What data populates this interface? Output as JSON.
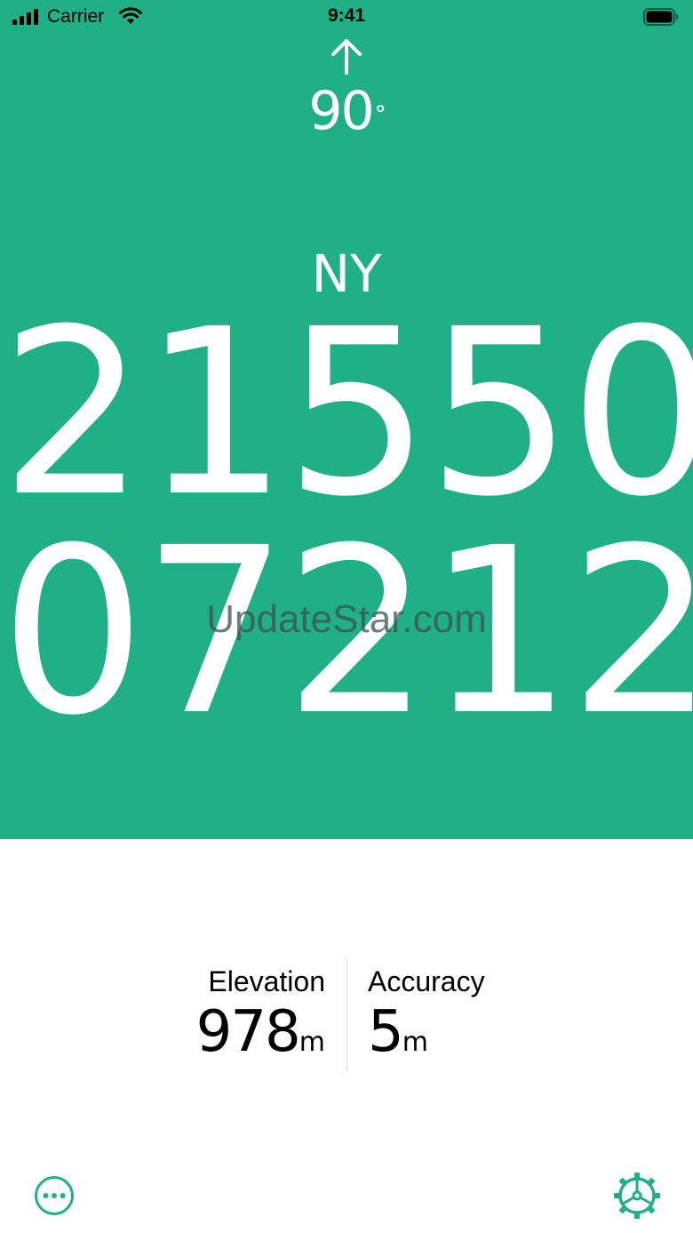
{
  "status_bar": {
    "carrier": "Carrier",
    "time": "9:41"
  },
  "heading": {
    "value": "90",
    "unit": "°"
  },
  "location": {
    "zone": "NY",
    "line1": "21550",
    "line2": "07212"
  },
  "watermark": "UpdateStar.com",
  "stats": {
    "elevation": {
      "label": "Elevation",
      "value": "978",
      "unit": "m"
    },
    "accuracy": {
      "label": "Accuracy",
      "value": "5",
      "unit": "m"
    }
  },
  "icons": {
    "more": "more-icon",
    "settings": "settings-icon",
    "heading_arrow": "arrow-up-icon"
  },
  "colors": {
    "accent": "#20b088",
    "background": "#ffffff",
    "text_dark": "#000000"
  }
}
